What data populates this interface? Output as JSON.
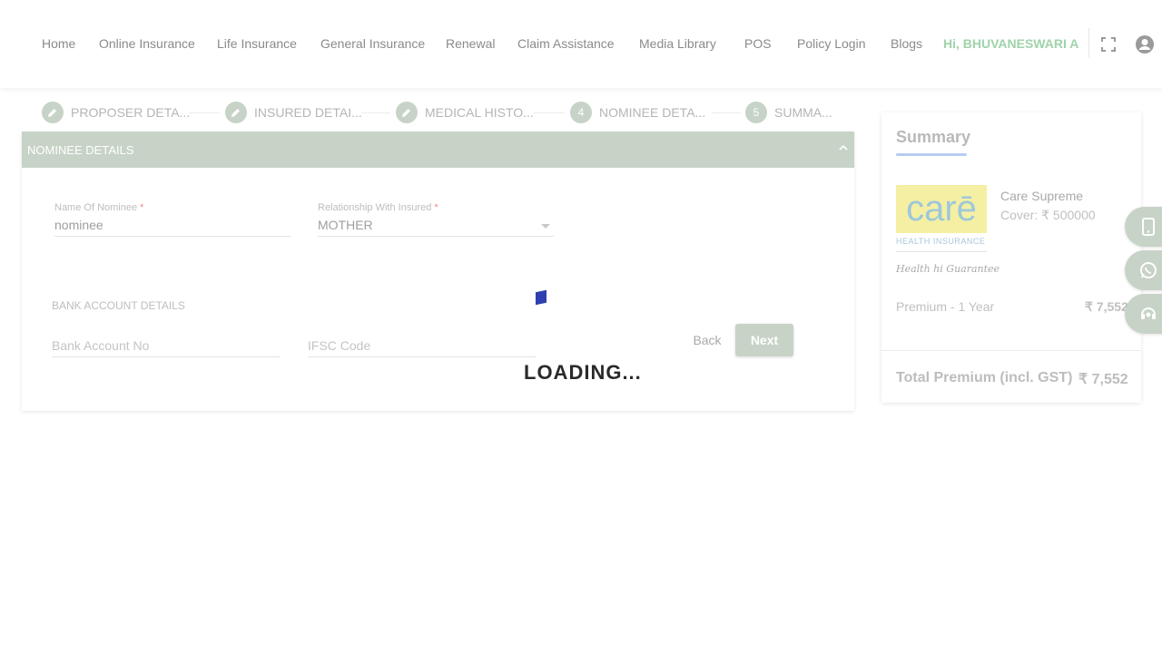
{
  "nav": {
    "items": [
      "Home",
      "Online Insurance",
      "Life Insurance",
      "General Insurance",
      "Renewal",
      "Claim Assistance",
      "Media Library",
      "POS",
      "Policy Login",
      "Blogs"
    ],
    "greeting": "Hi, BHUVANESWARI A",
    "fullscreen_icon": "fullscreen-icon",
    "account_icon": "account-circle-icon"
  },
  "stepper": {
    "steps": [
      {
        "marker": "edit",
        "label": "PROPOSER DETA..."
      },
      {
        "marker": "edit",
        "label": "INSURED DETAI..."
      },
      {
        "marker": "edit",
        "label": "MEDICAL HISTO..."
      },
      {
        "marker": "4",
        "label": "NOMINEE DETA..."
      },
      {
        "marker": "5",
        "label": "SUMMA..."
      }
    ]
  },
  "form": {
    "header": "NOMINEE DETAILS",
    "nominee_name": {
      "label": "Name Of Nominee",
      "required": "*",
      "value": "nominee"
    },
    "relationship": {
      "label": "Relationship With Insured",
      "required": "*",
      "value": "MOTHER"
    },
    "bank_section_title": "BANK ACCOUNT DETAILS",
    "bank_account": {
      "placeholder": "Bank Account No"
    },
    "ifsc": {
      "placeholder": "IFSC Code"
    },
    "back_label": "Back",
    "next_label": "Next"
  },
  "loading": {
    "text": "LOADING..."
  },
  "summary": {
    "title": "Summary",
    "logo_word": "carē",
    "logo_sub": "HEALTH INSURANCE",
    "logo_tagline": "Health hi Guarantee",
    "plan_name": "Care Supreme",
    "cover": "Cover: ₹ 500000",
    "premium_label": "Premium - 1 Year",
    "premium_value": "₹ 7,552",
    "total_label": "Total Premium (incl. GST)",
    "total_value": "₹ 7,552"
  },
  "side_buttons": [
    "mobile-phone-icon",
    "whatsapp-icon",
    "support-agent-icon"
  ],
  "colors": {
    "accent_green": "#c7d3c7",
    "greeting_green": "#9fd3a9",
    "spinner_blue": "#2f3fb0",
    "summary_underline": "#b7cdf0"
  }
}
